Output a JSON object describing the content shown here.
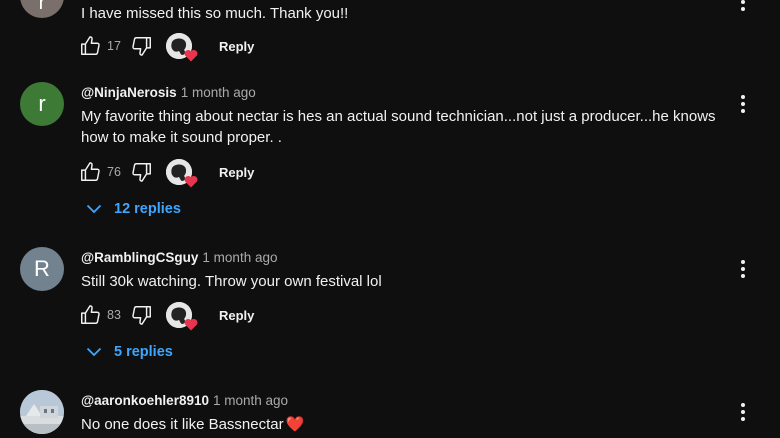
{
  "comments": [
    {
      "handle": "",
      "time": "",
      "avatar_letter": "r",
      "avatar_color": "#7a6f6a",
      "text": "I have missed this so much. Thank you!!",
      "likes": "17",
      "reply_label": "Reply"
    },
    {
      "handle": "@NinjaNerosis",
      "time": "1 month ago",
      "avatar_letter": "r",
      "avatar_color": "#3d7a36",
      "text": "My favorite thing about nectar is hes an actual sound technician...not just a producer...he knows how to make it sound proper. .",
      "likes": "76",
      "reply_label": "Reply",
      "replies_label": "12 replies"
    },
    {
      "handle": "@RamblingCSguy",
      "time": "1 month ago",
      "avatar_letter": "R",
      "avatar_color": "#73828f",
      "text": "Still 30k watching. Throw your own festival lol",
      "likes": "83",
      "reply_label": "Reply",
      "replies_label": "5 replies"
    },
    {
      "handle": "@aaronkoehler8910",
      "time": "1 month ago",
      "avatar_color": "#8fa3b5",
      "text": "No one does it like Bassnectar",
      "emoji": "❤️"
    }
  ],
  "colors": {
    "background": "#0f0f0f",
    "replies_link": "#3ea6ff",
    "heart": "#e8344e"
  },
  "icons": [
    "thumb-up-icon",
    "thumb-down-icon",
    "creator-heart-icon",
    "more-vert-icon",
    "chevron-down-icon"
  ]
}
